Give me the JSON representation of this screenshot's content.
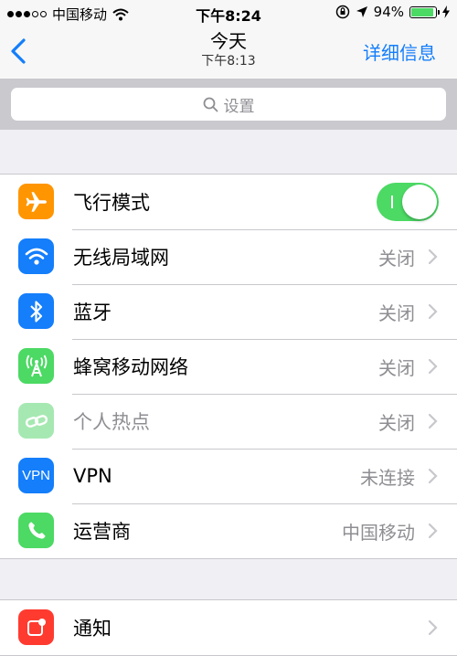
{
  "status_bar": {
    "carrier": "中国移动",
    "time": "下午8:24",
    "battery_percent_text": "94%",
    "battery_level": 0.94
  },
  "nav": {
    "back_icon": "chevron-left-icon",
    "title": "今天",
    "subtitle": "下午8:13",
    "right_button": "详细信息"
  },
  "search": {
    "placeholder": "设置",
    "icon": "search-icon"
  },
  "group1": [
    {
      "label": "飞行模式",
      "icon": "airplane-icon",
      "color": "#ff9500",
      "toggle_on": true
    },
    {
      "label": "无线局域网",
      "value": "关闭",
      "icon": "wifi-icon",
      "color": "#147efb"
    },
    {
      "label": "蓝牙",
      "value": "关闭",
      "icon": "bluetooth-icon",
      "color": "#147efb"
    },
    {
      "label": "蜂窝移动网络",
      "value": "关闭",
      "icon": "cellular-icon",
      "color": "#4cd964"
    },
    {
      "label": "个人热点",
      "value": "关闭",
      "icon": "hotspot-icon",
      "color": "#a6e8b2"
    },
    {
      "label": "VPN",
      "value": "未连接",
      "icon": "vpn-icon",
      "icon_text": "VPN",
      "color": "#147efb"
    },
    {
      "label": "运营商",
      "value": "中国移动",
      "icon": "phone-icon",
      "color": "#4cd964"
    }
  ],
  "group2": [
    {
      "label": "通知",
      "icon": "notifications-icon",
      "color": "#ff3b30"
    }
  ],
  "colors": {
    "accent": "#147efb",
    "toggle_on": "#4cd964",
    "secondary_text": "#8e8e93"
  }
}
